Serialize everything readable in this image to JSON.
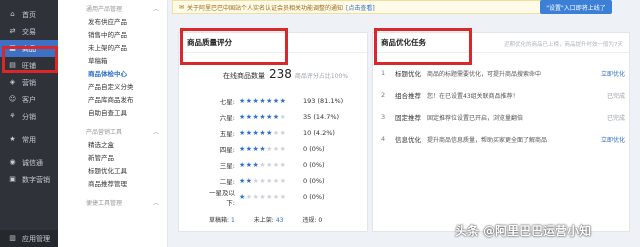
{
  "notice": {
    "text": "关于阿里巴巴中国站个人实名认证会员相关功能调整的通知",
    "link": "[点击查看]",
    "promo": "\"设置\"入口即将上线了"
  },
  "sidebar": [
    {
      "icon": "home-icon",
      "glyph": "⌂",
      "label": "首页"
    },
    {
      "icon": "trade-icon",
      "glyph": "⇄",
      "label": "交易"
    },
    {
      "icon": "goods-icon",
      "glyph": "▦",
      "label": "商品",
      "active": true
    },
    {
      "icon": "store-icon",
      "glyph": "▤",
      "label": "旺铺"
    },
    {
      "icon": "marketing-icon",
      "glyph": "◈",
      "label": "营销"
    },
    {
      "icon": "customer-icon",
      "glyph": "☺",
      "label": "客户"
    },
    {
      "icon": "distribution-icon",
      "glyph": "⚘",
      "label": "分销"
    },
    {
      "icon": "common-icon",
      "glyph": "★",
      "label": "常用"
    },
    {
      "icon": "integrity-icon",
      "glyph": "◉",
      "label": "诚信通"
    },
    {
      "icon": "digital-icon",
      "glyph": "▣",
      "label": "数字营销"
    },
    {
      "icon": "app-icon",
      "glyph": "▥",
      "label": "应用管理"
    }
  ],
  "submenu": {
    "group1_title": "通用产品管理",
    "group1_items": [
      "发布供应产品",
      "销售中的产品",
      "未上架的产品",
      "草稿箱",
      "商品体检中心",
      "产品自定义分类",
      "产品库商品发布",
      "自助自查工具"
    ],
    "group2_title": "产品营销工具",
    "group2_items": [
      "精选之盒",
      "新管产品",
      "标题优化工具",
      "商品推荐管理"
    ],
    "group3_title": "便捷工具管理",
    "active_item": "商品体检中心"
  },
  "quality": {
    "title": "商品质量评分",
    "total_label": "在线商品数量",
    "total_value": "238",
    "total_note": "商品评分占比100%",
    "ratings": [
      {
        "label": "七星:",
        "filled": 7,
        "count": "193 (81.1%)"
      },
      {
        "label": "六星:",
        "filled": 6,
        "count": "35 (14.7%)"
      },
      {
        "label": "五星:",
        "filled": 5,
        "count": "10 (4.2%)"
      },
      {
        "label": "四星:",
        "filled": 4,
        "count": "0 (0%)"
      },
      {
        "label": "三星:",
        "filled": 3,
        "count": "0 (0%)"
      },
      {
        "label": "二星:",
        "filled": 2,
        "count": "0 (0%)"
      },
      {
        "label": "一星及以下:",
        "filled": 1,
        "count": "0 (0%)"
      }
    ],
    "footer": {
      "draft_label": "草稿箱:",
      "draft_value": "1",
      "unlisted_label": "未上架:",
      "unlisted_value": "43",
      "violation_label": "违规:",
      "violation_value": "0"
    }
  },
  "optimize": {
    "title": "商品优化任务",
    "subtitle": "近期优化的商品已上榜，商品提升时效一般为7天",
    "tasks": [
      {
        "num": "1",
        "name": "标题优化",
        "desc": "商品的标题需要优化，可提升商品搜索命中",
        "action": "立即优化",
        "state": "link"
      },
      {
        "num": "2",
        "name": "组合推荐",
        "desc": "您！在已设置43组关联商品推荐！",
        "action": "已完成",
        "state": "done"
      },
      {
        "num": "3",
        "name": "固定推荐",
        "desc": "固定推荐位设置已开启，浏览量翻倍",
        "action": "已完成",
        "state": "done"
      },
      {
        "num": "4",
        "name": "信息优化",
        "desc": "提升商品信息质量，帮助买家更全面了解商品",
        "action": "立即优化",
        "state": "link"
      }
    ]
  },
  "watermark": "头条 @阿里巴巴运营小知"
}
